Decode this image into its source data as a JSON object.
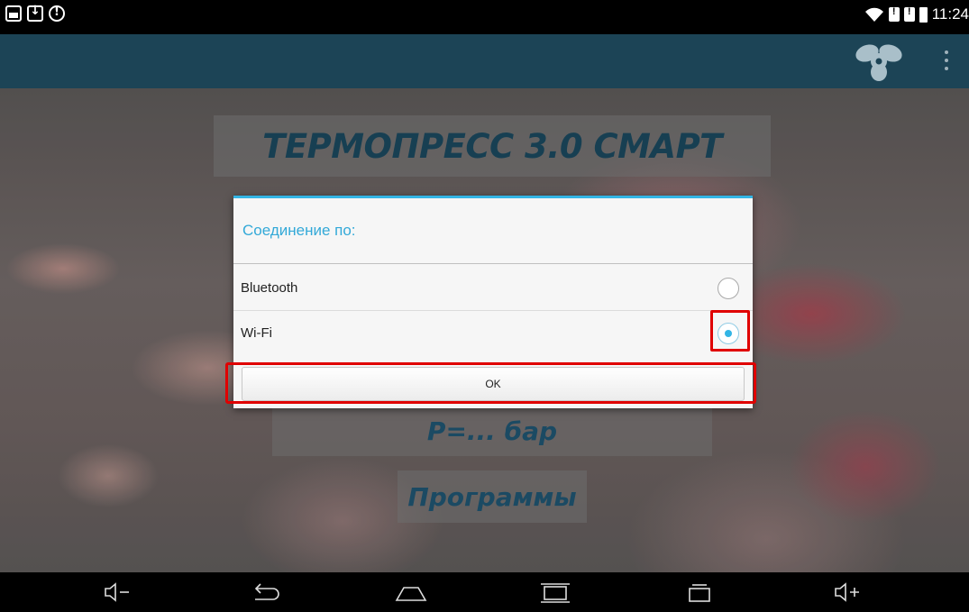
{
  "status_bar": {
    "time": "11:24"
  },
  "app": {
    "title": "ТЕРМОПРЕСС 3.0 СМАРТ",
    "pressure_label": "P=... бар",
    "programs_label": "Программы"
  },
  "dialog": {
    "title": "Соединение по:",
    "options": [
      {
        "label": "Bluetooth",
        "selected": false
      },
      {
        "label": "Wi-Fi",
        "selected": true
      }
    ],
    "ok_label": "OK"
  },
  "colors": {
    "accent": "#33b5e5",
    "action_bar": "#1c4456",
    "highlight": "#e00000",
    "title_text": "#173f52"
  }
}
